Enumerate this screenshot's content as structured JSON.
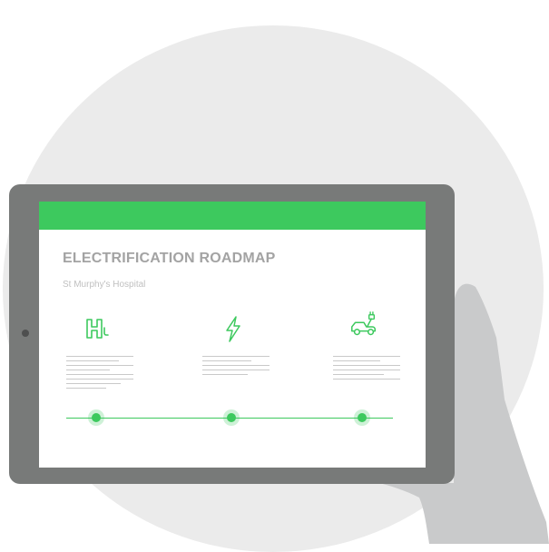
{
  "colors": {
    "accent": "#3dc95e",
    "bezel": "#787a79",
    "circle": "#ebebeb",
    "hand": "#c9cacb",
    "text_heading": "#a3a3a3",
    "text_sub": "#c0c0c0",
    "text_lines": "#c9c9c9"
  },
  "document": {
    "title": "ELECTRIFICATION ROADMAP",
    "subtitle": "St Murphy's Hospital"
  },
  "stages": [
    {
      "icon": "hydrogen-icon"
    },
    {
      "icon": "lightning-bolt-icon"
    },
    {
      "icon": "electric-car-plug-icon"
    }
  ]
}
